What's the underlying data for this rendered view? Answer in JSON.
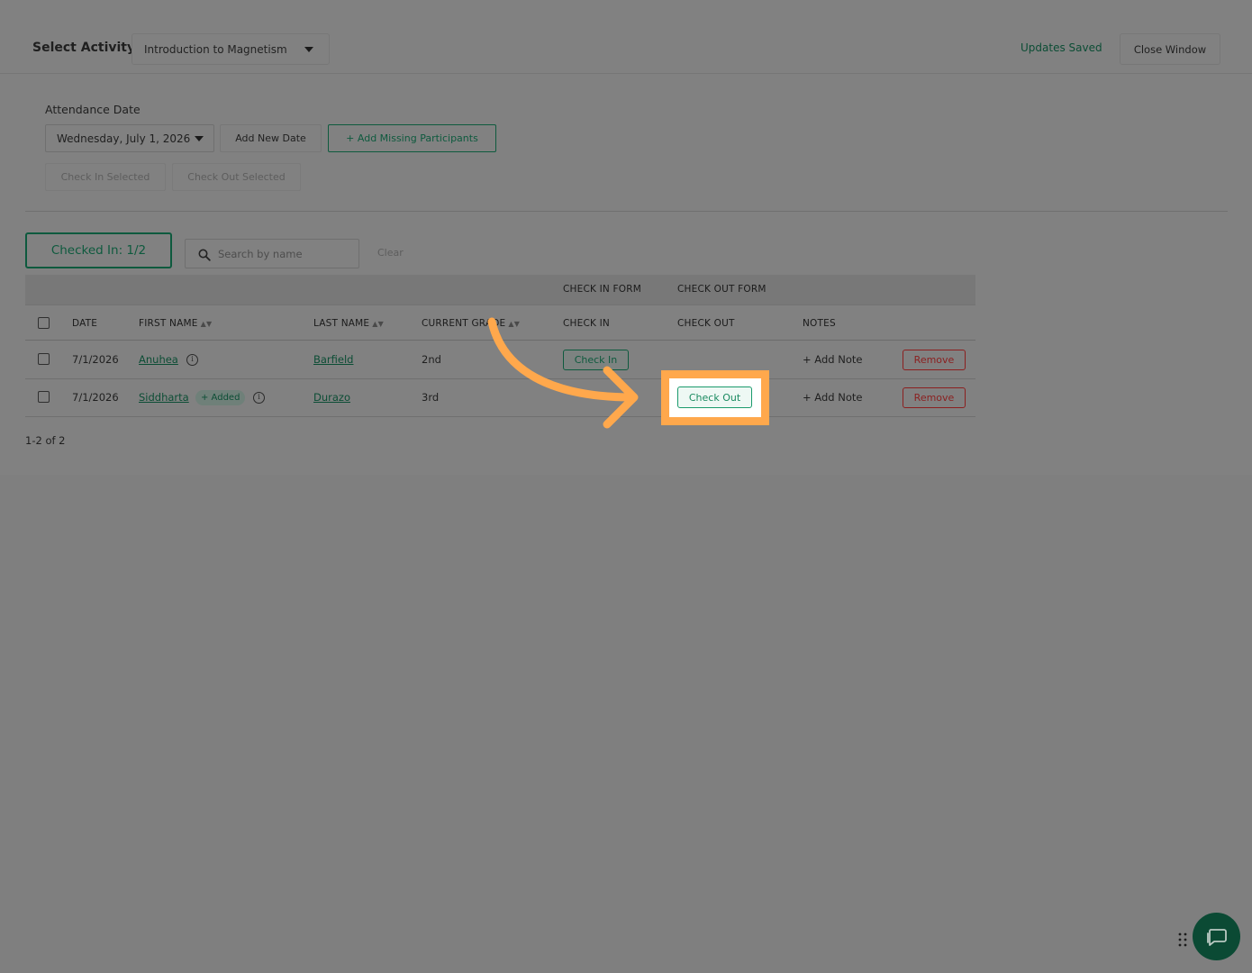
{
  "header": {
    "select_activity_label": "Select Activity:",
    "activity_selected": "Introduction to Magnetism",
    "status": "Updates Saved",
    "close_window": "Close Window"
  },
  "attendance": {
    "label": "Attendance Date",
    "selected_date": "Wednesday, July 1, 2026",
    "add_new_date": "Add New Date",
    "add_missing": "+ Add Missing Participants",
    "check_in_selected": "Check In Selected",
    "check_out_selected": "Check Out Selected"
  },
  "summary": {
    "checked_in": "Checked In: 1/2",
    "search_placeholder": "Search by name",
    "clear": "Clear"
  },
  "table": {
    "group_headers": {
      "check_in_form": "CHECK IN FORM",
      "check_out_form": "CHECK OUT FORM"
    },
    "columns": {
      "date": "DATE",
      "first_name": "FIRST NAME",
      "last_name": "LAST NAME",
      "current_grade": "CURRENT GRADE",
      "check_in": "CHECK IN",
      "check_out": "CHECK OUT",
      "notes": "NOTES"
    },
    "sort_glyph": "▲▼",
    "rows": [
      {
        "date": "7/1/2026",
        "first_name": "Anuhea",
        "last_name": "Barfield",
        "grade": "2nd",
        "check_in_label": "Check In",
        "notes": "+ Add Note",
        "remove": "Remove"
      },
      {
        "date": "7/1/2026",
        "first_name": "Siddharta",
        "added_badge": "+ Added",
        "last_name": "Durazo",
        "grade": "3rd",
        "check_out_label": "Check Out",
        "notes": "+ Add Note",
        "remove": "Remove"
      }
    ]
  },
  "pagination": "1-2 of 2",
  "icons": {
    "info": "i"
  },
  "colors": {
    "accent_green": "#0e5a3e",
    "highlight_orange": "#ffa84c",
    "remove_red": "#8b1f1f",
    "overlay_gray": "#7f7f7f"
  }
}
